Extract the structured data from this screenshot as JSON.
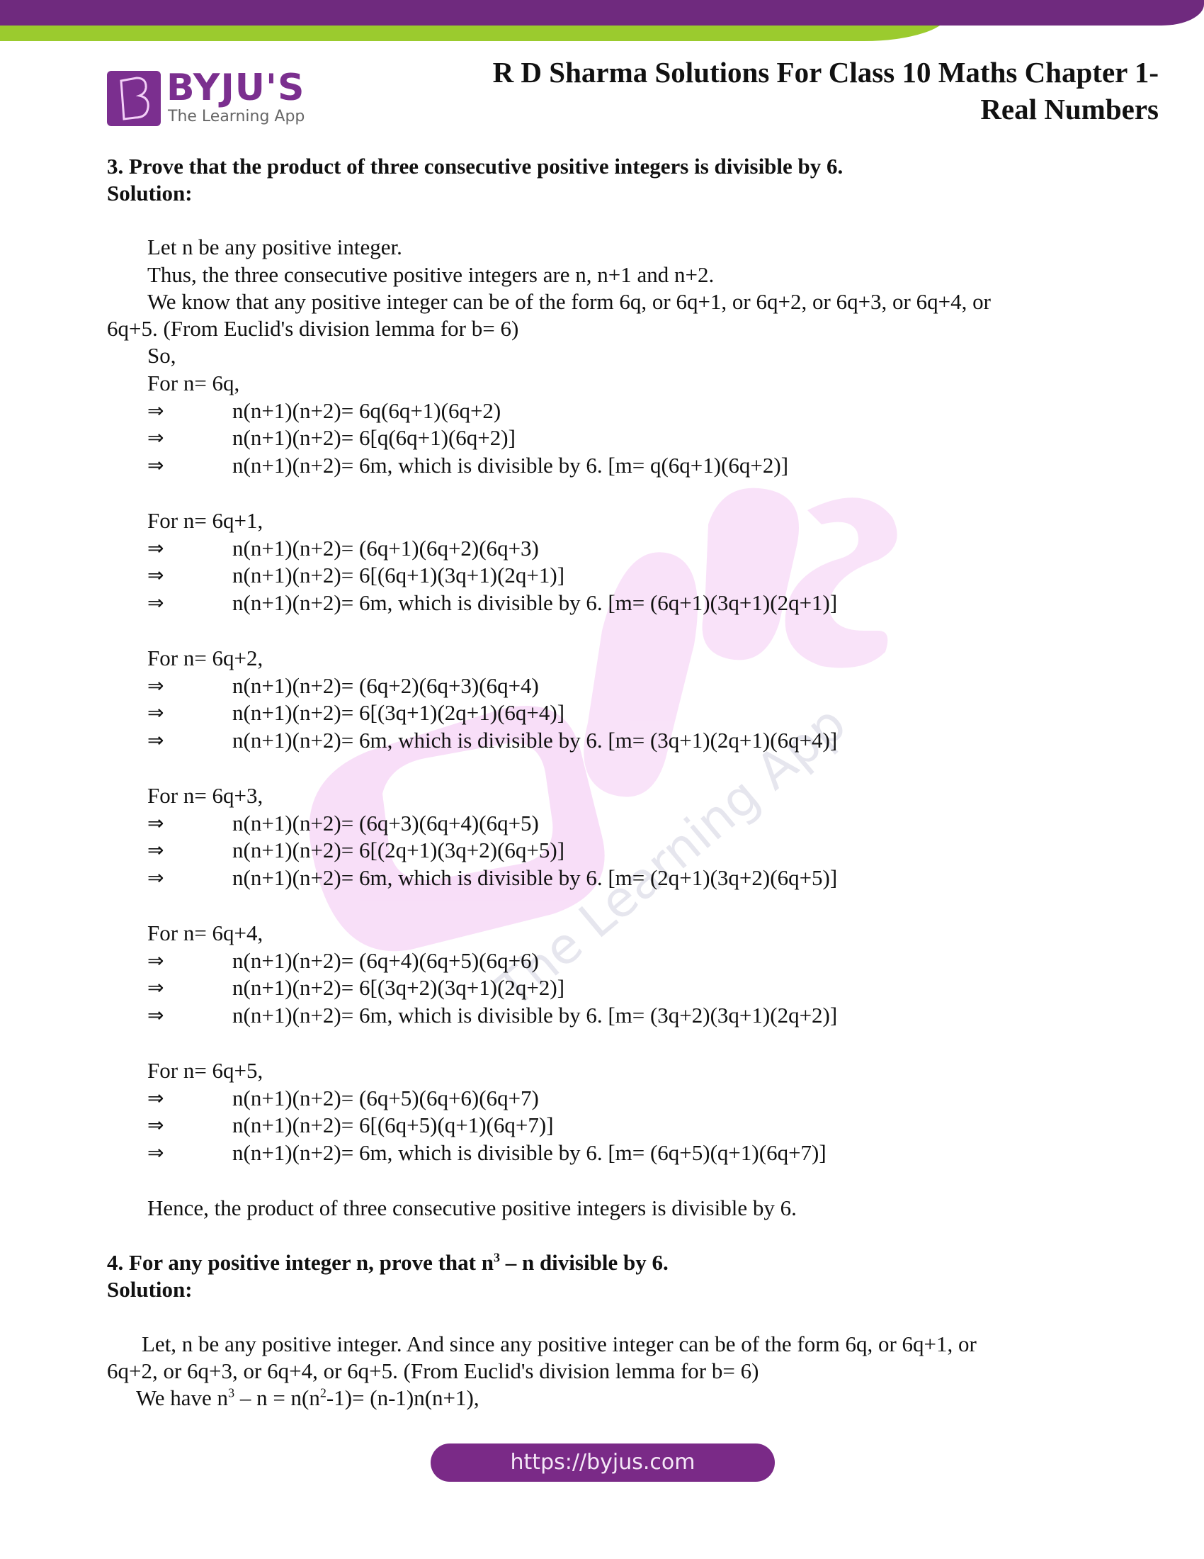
{
  "header": {
    "brand_name": "BYJU'S",
    "brand_tagline": "The Learning App",
    "brand_icon": "byjus-b-logo-icon",
    "title_line1": "R D Sharma Solutions For Class 10 Maths Chapter 1-",
    "title_line2": "Real Numbers",
    "colors": {
      "purple": "#6f2a7e",
      "green": "#9bcb2e",
      "logo_purple": "#7b2f8f"
    }
  },
  "watermark": {
    "brand": "BYJU'S",
    "tagline": "The Learning App"
  },
  "q3": {
    "question": "3.  Prove that the product of three consecutive positive integers is divisible by 6.",
    "solution_label": "Solution:",
    "intro": [
      "Let n be any positive integer.",
      "Thus, the three consecutive positive integers are n, n+1 and n+2.",
      "We know that any positive integer can be of the form 6q, or 6q+1, or 6q+2, or 6q+3, or 6q+4, or",
      "6q+5. (From Euclid's division lemma for b= 6)",
      "So,"
    ],
    "arrow_symbol": "⇒",
    "cases": [
      {
        "label": "For n= 6q,",
        "steps": [
          "n(n+1)(n+2)= 6q(6q+1)(6q+2)",
          "n(n+1)(n+2)= 6[q(6q+1)(6q+2)]",
          "n(n+1)(n+2)= 6m, which is divisible by 6.  [m= q(6q+1)(6q+2)]"
        ]
      },
      {
        "label": "For n= 6q+1,",
        "steps": [
          "n(n+1)(n+2)= (6q+1)(6q+2)(6q+3)",
          "n(n+1)(n+2)= 6[(6q+1)(3q+1)(2q+1)]",
          "n(n+1)(n+2)= 6m, which is divisible by 6.  [m= (6q+1)(3q+1)(2q+1)]"
        ]
      },
      {
        "label": "For n= 6q+2,",
        "steps": [
          "n(n+1)(n+2)= (6q+2)(6q+3)(6q+4)",
          "n(n+1)(n+2)= 6[(3q+1)(2q+1)(6q+4)]",
          "n(n+1)(n+2)= 6m, which is divisible by 6.  [m= (3q+1)(2q+1)(6q+4)]"
        ]
      },
      {
        "label": "For n= 6q+3,",
        "steps": [
          "n(n+1)(n+2)= (6q+3)(6q+4)(6q+5)",
          "n(n+1)(n+2)= 6[(2q+1)(3q+2)(6q+5)]",
          "n(n+1)(n+2)= 6m, which is divisible by 6.  [m= (2q+1)(3q+2)(6q+5)]"
        ]
      },
      {
        "label": "For n= 6q+4,",
        "steps": [
          "n(n+1)(n+2)= (6q+4)(6q+5)(6q+6)",
          "n(n+1)(n+2)= 6[(3q+2)(3q+1)(2q+2)]",
          "n(n+1)(n+2)= 6m, which is divisible by 6.  [m= (3q+2)(3q+1)(2q+2)]"
        ]
      },
      {
        "label": "For n= 6q+5,",
        "steps": [
          "n(n+1)(n+2)= (6q+5)(6q+6)(6q+7)",
          "n(n+1)(n+2)= 6[(6q+5)(q+1)(6q+7)]",
          "n(n+1)(n+2)= 6m, which is divisible by 6.  [m= (6q+5)(q+1)(6q+7)]"
        ]
      }
    ],
    "conclusion": "Hence, the product of three consecutive positive integers is divisible by 6."
  },
  "q4": {
    "question_pre": "4. For any positive integer n, prove that n",
    "question_sup": "3",
    "question_post": " – n divisible by 6.",
    "solution_label": "Solution:",
    "line1": "Let, n be any positive integer. And since any positive integer can be of the form 6q, or 6q+1, or",
    "line2": "6q+2, or 6q+3, or 6q+4, or 6q+5. (From Euclid's division lemma for b= 6)",
    "line3_a": "We have n",
    "line3_sup1": "3",
    "line3_b": " – n = n(n",
    "line3_sup2": "2",
    "line3_c": "-1)= (n-1)n(n+1),"
  },
  "footer": {
    "url": "https://byjus.com"
  }
}
